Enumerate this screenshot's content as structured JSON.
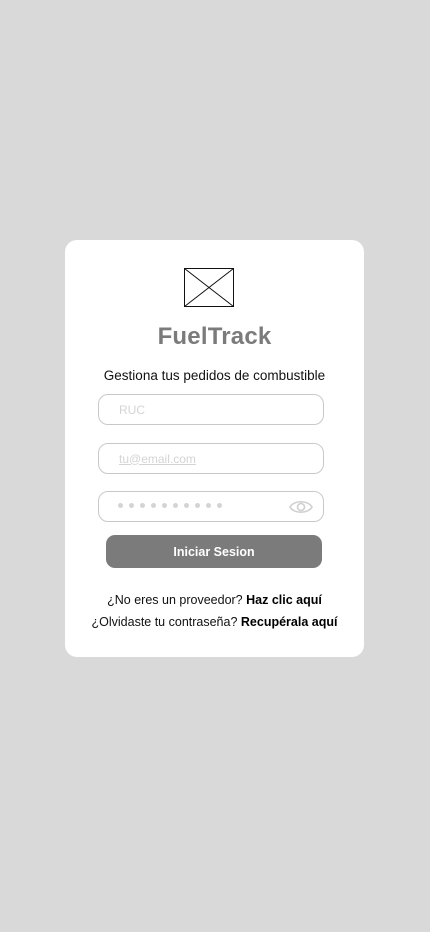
{
  "login": {
    "app_title": "FuelTrack",
    "subtitle": "Gestiona tus pedidos de combustible",
    "ruc_placeholder": "RUC",
    "email_placeholder": "tu@email.com",
    "password_dots": "••••••••••",
    "login_button": "Iniciar Sesion",
    "provider_prompt": "¿No eres un proveedor?",
    "provider_link": "Haz clic aquí",
    "forgot_prompt": "¿Olvidaste tu contraseña?",
    "forgot_link": "Recupérala aquí"
  },
  "icons": {
    "logo": "image-placeholder-icon",
    "password_toggle": "eye-icon"
  },
  "colors": {
    "background": "#d9d9d9",
    "card": "#ffffff",
    "title": "#7b7b7b",
    "button": "#7b7b7b",
    "field_border": "#c9c9c9",
    "placeholder": "#d4d4d4"
  }
}
